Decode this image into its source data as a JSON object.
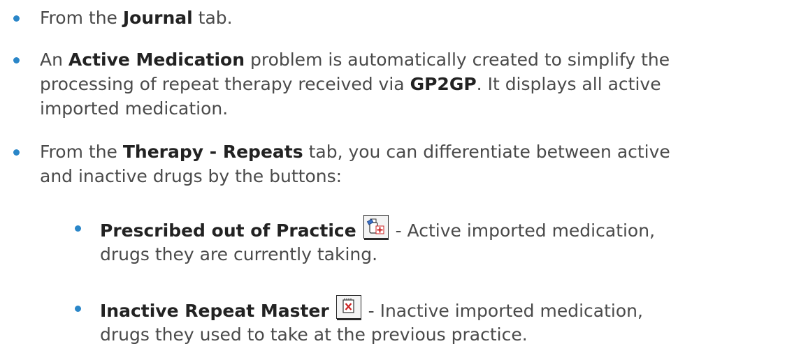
{
  "bullets": {
    "b1": {
      "pre": "From the ",
      "bold": "Journal",
      "post": " tab."
    },
    "b2": {
      "line1_pre": "An ",
      "line1_bold": "Active Medication",
      "line1_post": " problem is automatically created to simplify the",
      "line2_pre": "processing of repeat therapy received via ",
      "line2_bold": "GP2GP",
      "line2_post": ". It displays all active",
      "line3": "imported medication."
    },
    "b3": {
      "line1_pre": "From the ",
      "line1_bold": "Therapy - Repeats",
      "line1_post": " tab, you can differentiate between active",
      "line2": "and inactive drugs by the buttons:"
    },
    "sub1": {
      "bold": "Prescribed out of Practice",
      "icon": "prescribed-out-of-practice-icon",
      "post": " - Active imported medication,",
      "line2": "drugs they are currently taking."
    },
    "sub2": {
      "bold": "Inactive Repeat Master",
      "icon": "inactive-repeat-master-icon",
      "post": " - Inactive imported medication,",
      "line2": "drugs they used to take at the previous practice."
    }
  },
  "colors": {
    "bullet": "#2a86c8",
    "text": "#4a4a4a",
    "icon_red": "#cc2222",
    "icon_blue": "#3a6fc4"
  }
}
